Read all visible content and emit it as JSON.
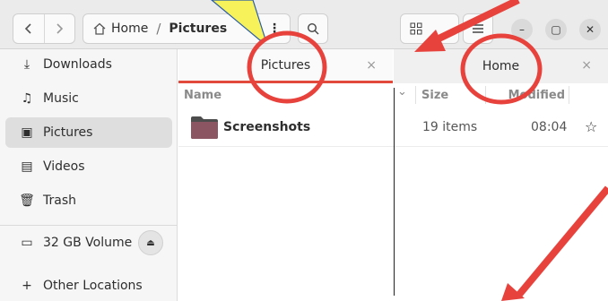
{
  "header": {
    "back_icon": "chevron-left-icon",
    "forward_icon": "chevron-right-icon",
    "path_home_label": "Home",
    "path_separator": "/",
    "path_current": "Pictures",
    "path_menu_label": "⋮",
    "search_icon": "search-icon",
    "view_icon": "grid-view-icon",
    "main_menu_icon": "hamburger-menu-icon",
    "minimize_label": "–",
    "maximize_label": "▢",
    "close_label": "✕"
  },
  "sidebar": {
    "items": [
      {
        "label": "Downloads",
        "icon": "download-icon",
        "glyph": "⤓"
      },
      {
        "label": "Music",
        "icon": "music-icon",
        "glyph": "♫"
      },
      {
        "label": "Pictures",
        "icon": "picture-icon",
        "glyph": "▣"
      },
      {
        "label": "Videos",
        "icon": "film-icon",
        "glyph": "▤"
      },
      {
        "label": "Trash",
        "icon": "trash-icon",
        "glyph": "🗑"
      }
    ],
    "volume": {
      "label": "32 GB Volume",
      "icon": "drive-icon",
      "glyph": "▭",
      "eject_glyph": "⏏"
    },
    "other": {
      "label": "Other Locations",
      "icon": "plus-icon",
      "glyph": "+"
    }
  },
  "tabs": [
    {
      "label": "Pictures",
      "close": "×",
      "active": true
    },
    {
      "label": "Home",
      "close": "×",
      "active": false
    }
  ],
  "columns": {
    "name": "Name",
    "sort_glyph": "⌄",
    "size": "Size",
    "modified": "Modified"
  },
  "files": [
    {
      "name": "Screenshots",
      "size": "19 items",
      "modified": "08:04",
      "star": "☆"
    }
  ],
  "colors": {
    "accent": "#e24b3b",
    "annotation_red": "#e8423d",
    "annotation_yellow": "#f7f25a"
  }
}
